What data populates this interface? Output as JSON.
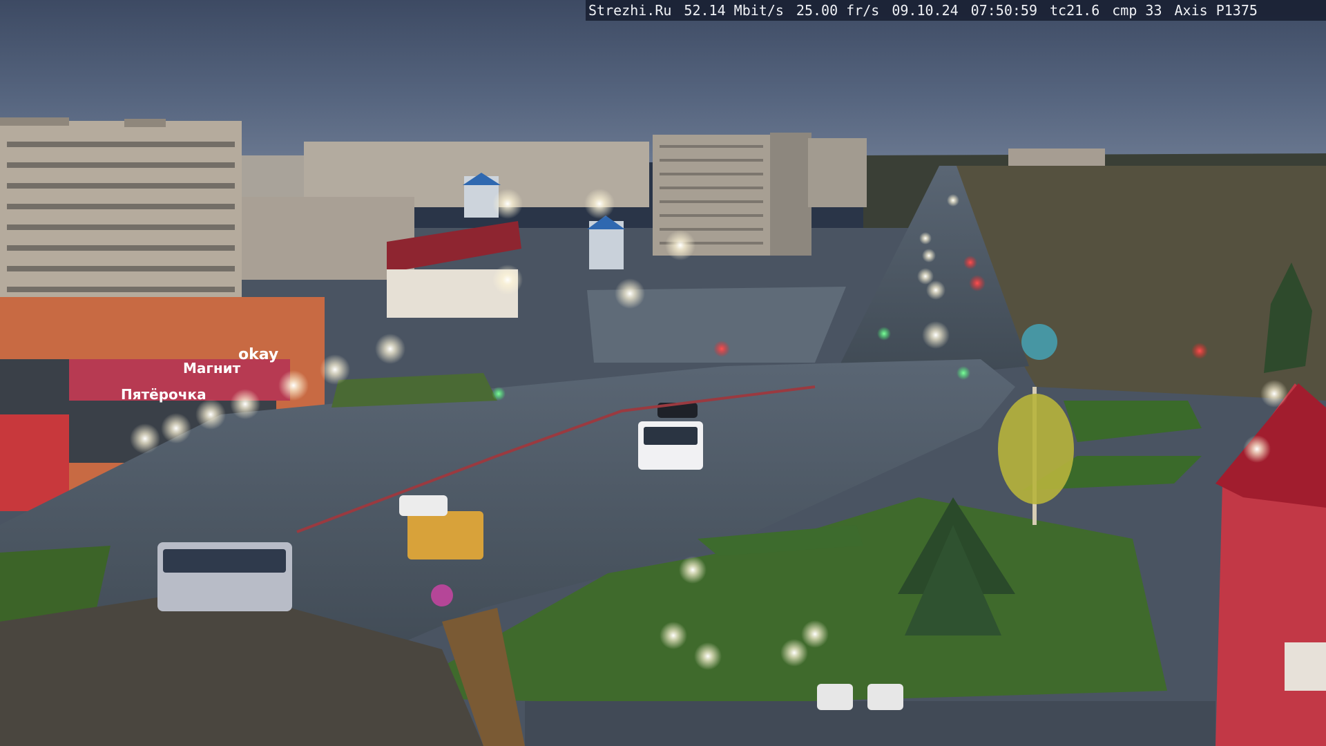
{
  "overlay": {
    "site": "Strezhi.Ru",
    "bitrate": "52.14 Mbit/s",
    "framerate": "25.00 fr/s",
    "date": "09.10.24",
    "time": "07:50:59",
    "tc": "tc21.6",
    "cmp": "cmp 33",
    "camera": "Axis P1375"
  },
  "signage": {
    "store_sign_1": "Пятёрочка",
    "store_sign_2": "Магнит",
    "store_sign_3": "okay"
  },
  "colors": {
    "sky": "#4a5a74",
    "road": "#4e5a66",
    "grass": "#3f6a2c",
    "building_red": "#b5303a"
  }
}
